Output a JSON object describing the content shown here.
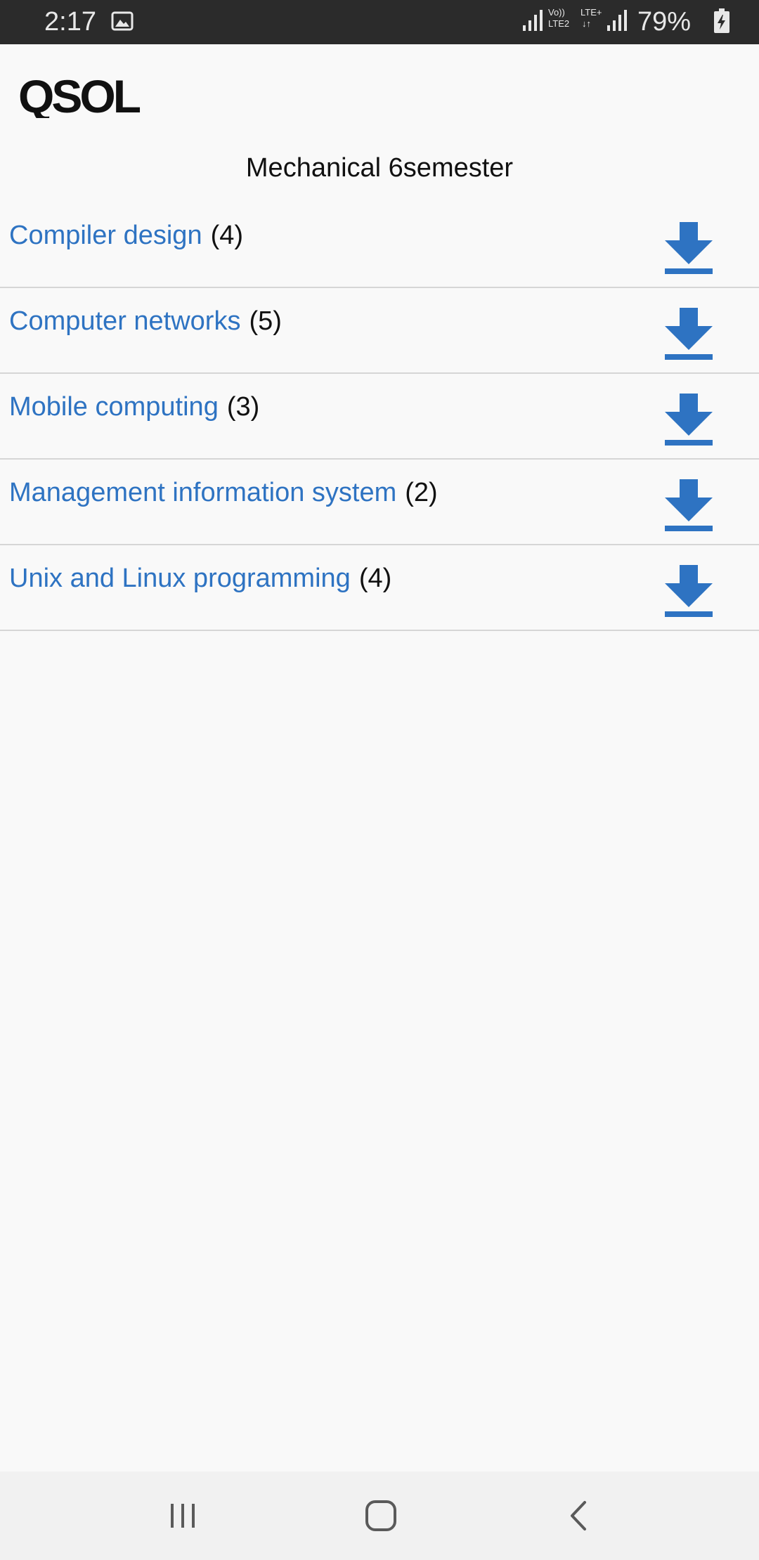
{
  "status_bar": {
    "time": "2:17",
    "network_top": "LTE+",
    "network_volte": "Vo))",
    "network_lte2": "LTE2",
    "network_arrows": "↓↑",
    "battery": "79%",
    "icons": [
      "gallery-icon",
      "signal-icon",
      "signal-icon",
      "battery-charging-icon"
    ]
  },
  "header": {
    "logo_text": "QSOL"
  },
  "page": {
    "title": "Mechanical 6semester"
  },
  "subjects": [
    {
      "name": "Compiler design",
      "count": "(4)"
    },
    {
      "name": "Computer networks",
      "count": "(5)"
    },
    {
      "name": "Mobile computing",
      "count": "(3)"
    },
    {
      "name": "Management information system",
      "count": "(2)"
    },
    {
      "name": "Unix and Linux programming",
      "count": "(4)"
    }
  ],
  "colors": {
    "link": "#2e73c2",
    "download_icon": "#2e73c2",
    "status_bar_bg": "#2b2b2b",
    "page_bg": "#f9f9f9"
  },
  "nav_bar": {
    "icons": [
      "recent-apps-icon",
      "home-icon",
      "back-icon"
    ]
  }
}
